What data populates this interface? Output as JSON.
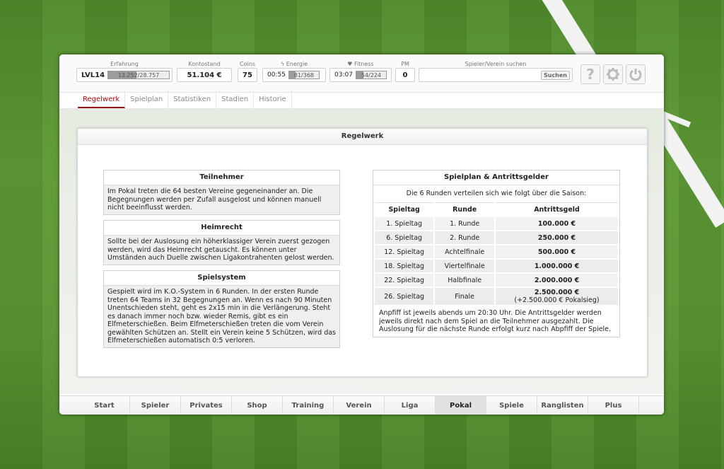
{
  "stats": {
    "experience": {
      "label": "Erfahrung",
      "level": "LVL14",
      "progress_text": "13.252/28.757",
      "progress_fraction": 0.46
    },
    "balance": {
      "label": "Kontostand",
      "value": "51.104 €"
    },
    "coins": {
      "label": "Coins",
      "value": "75"
    },
    "energy": {
      "label": "Energie",
      "icon": "lightning-icon",
      "timer": "00:55",
      "progress_text": "81/368",
      "progress_fraction": 0.22
    },
    "fitness": {
      "label": "Fitness",
      "icon": "heart-icon",
      "timer": "03:07",
      "progress_text": "54/224",
      "progress_fraction": 0.24
    },
    "pm": {
      "label": "PM",
      "value": "0"
    },
    "search": {
      "label": "Spieler/Verein suchen",
      "placeholder": "",
      "button": "Suchen"
    }
  },
  "header_buttons": {
    "help": "?",
    "settings": "settings-gear-icon",
    "logout": "power-icon"
  },
  "tabs": [
    {
      "label": "Regelwerk",
      "active": true
    },
    {
      "label": "Spielplan"
    },
    {
      "label": "Statistiken"
    },
    {
      "label": "Stadien"
    },
    {
      "label": "Historie"
    }
  ],
  "panel": {
    "title": "Regelwerk",
    "participants": {
      "title": "Teilnehmer",
      "text": "Im Pokal treten die 64 besten Vereine gegeneinander an. Die Begegnungen werden per Zufall ausgelost und können manuell nicht beeinflusst werden."
    },
    "home_right": {
      "title": "Heimrecht",
      "text": "Sollte bei der Auslosung ein höherklassiger Verein zuerst gezogen werden, wird das Heimrecht getauscht. Es können unter Umständen auch Duelle zwischen Ligakontrahenten gelost werden."
    },
    "system": {
      "title": "Spielsystem",
      "text": "Gespielt wird im K.O.-System in 6 Runden. In der ersten Runde treten 64 Teams in 32 Begegnungen an. Wenn es nach 90 Minuten Unentschieden steht, geht es 2x15 min in die Verlängerung. Steht es danach immer noch bzw. wieder Remis, gibt es ein Elfmeterschießen. Beim Elfmeterschießen treten die vom Verein gewählten Schützen an. Stellt ein Verein keine 5 Schützen, wird das Elfmeterschießen automatisch 0:5 verloren."
    },
    "schedule": {
      "title": "Spielplan & Antrittsgelder",
      "intro": "Die 6 Runden verteilen sich wie folgt über die Saison:",
      "columns": [
        "Spieltag",
        "Runde",
        "Antrittsgeld"
      ],
      "rows": [
        {
          "day": "1. Spieltag",
          "round": "1. Runde",
          "fee": "100.000 €",
          "extra": ""
        },
        {
          "day": "6. Spieltag",
          "round": "2. Runde",
          "fee": "250.000 €",
          "extra": ""
        },
        {
          "day": "12. Spieltag",
          "round": "Achtelfinale",
          "fee": "500.000 €",
          "extra": ""
        },
        {
          "day": "18. Spieltag",
          "round": "Viertelfinale",
          "fee": "1.000.000 €",
          "extra": ""
        },
        {
          "day": "22. Spieltag",
          "round": "Halbfinale",
          "fee": "2.000.000 €",
          "extra": ""
        },
        {
          "day": "26. Spieltag",
          "round": "Finale",
          "fee": "2.500.000 €",
          "extra": "(+2.500.000 € Pokalsieg)"
        }
      ],
      "footer": "Anpfiff ist jeweils abends um 20:30 Uhr. Die Antrittsgelder werden jeweils direkt nach dem Spiel an die Teilnehmer ausgezahlt. Die Auslosung für die nächste Runde erfolgt kurz nach Abpfiff der Spiele."
    }
  },
  "bottom_nav": [
    {
      "label": "Start"
    },
    {
      "label": "Spieler"
    },
    {
      "label": "Privates"
    },
    {
      "label": "Shop"
    },
    {
      "label": "Training"
    },
    {
      "label": "Verein"
    },
    {
      "label": "Liga"
    },
    {
      "label": "Pokal",
      "active": true
    },
    {
      "label": "Spiele"
    },
    {
      "label": "Ranglisten"
    },
    {
      "label": "Plus"
    }
  ]
}
